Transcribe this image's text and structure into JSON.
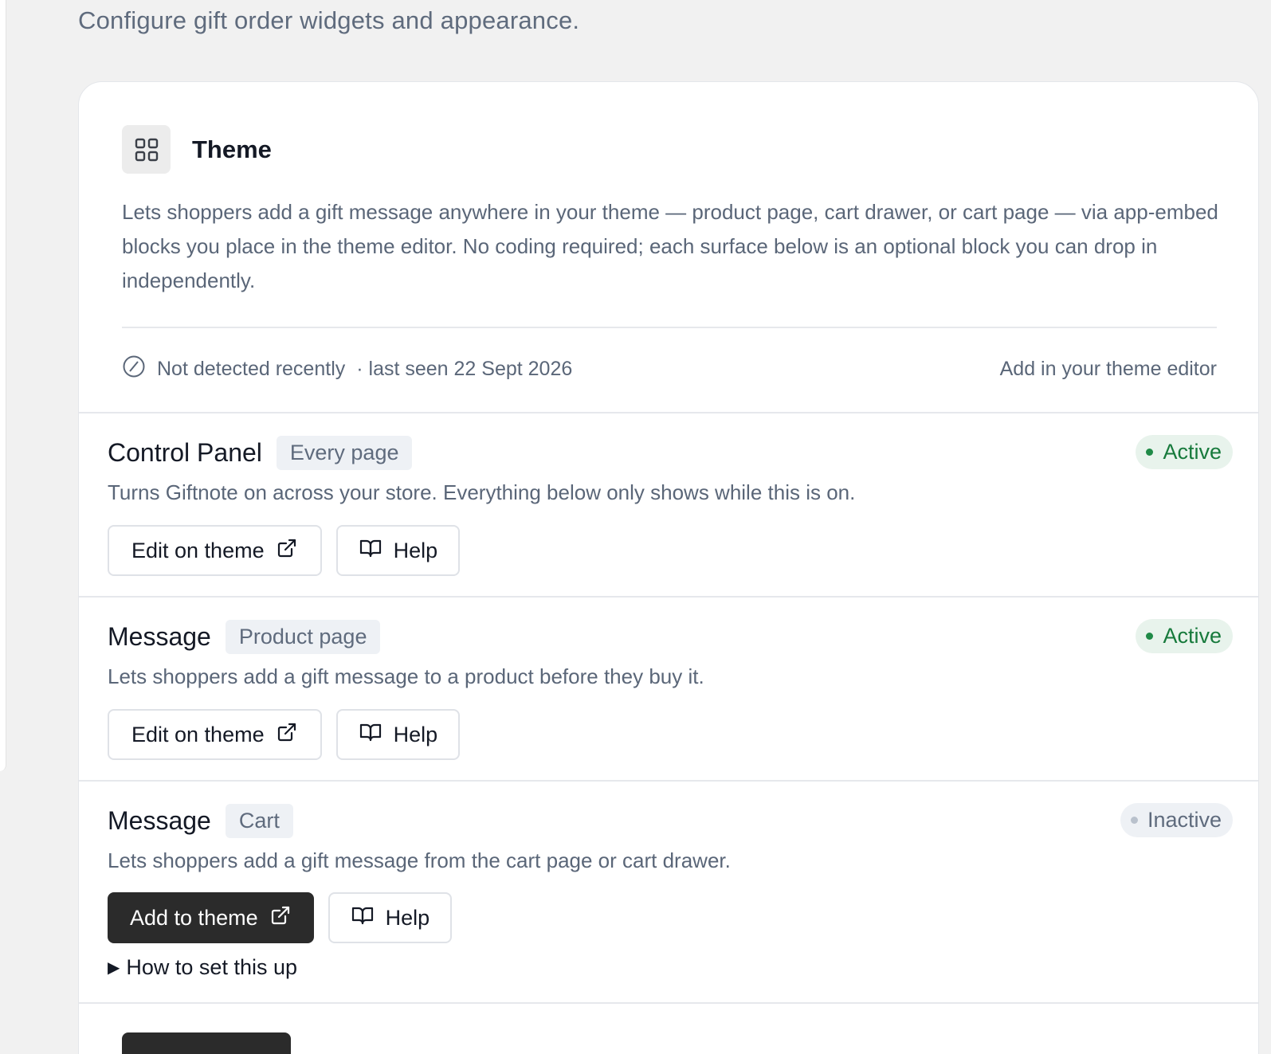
{
  "page": {
    "subtitle": "Configure gift order widgets and appearance."
  },
  "card": {
    "icon": "grid-icon",
    "title": "Theme",
    "description": "Lets shoppers add a gift message anywhere in your theme — product page, cart drawer, or cart page — via app-embed blocks you place in the theme editor. No coding required; each surface below is an optional block you can drop in independently.",
    "status": {
      "icon": "not-detected-icon",
      "text": "Not detected recently",
      "last_seen": "· last seen 22 Sept 2026",
      "editor_link": "Add in your theme editor"
    }
  },
  "sections": [
    {
      "title": "Control Panel",
      "tag": "Every page",
      "status": "Active",
      "description": "Turns Giftnote on across your store. Everything below only shows while this is on.",
      "primary_button": "Edit on theme",
      "help_button": "Help"
    },
    {
      "title": "Message",
      "tag": "Product page",
      "status": "Active",
      "description": "Lets shoppers add a gift message to a product before they buy it.",
      "primary_button": "Edit on theme",
      "help_button": "Help"
    },
    {
      "title": "Message",
      "tag": "Cart",
      "status": "Inactive",
      "description": "Lets shoppers add a gift message from the cart page or cart drawer.",
      "primary_button": "Add to theme",
      "help_button": "Help",
      "disclosure": "How to set this up"
    }
  ],
  "colors": {
    "background": "#f1f1f1",
    "card": "#ffffff",
    "active_green": "#177a3c",
    "primary_button": "#2b2b2b",
    "muted_text": "#5a6678"
  }
}
